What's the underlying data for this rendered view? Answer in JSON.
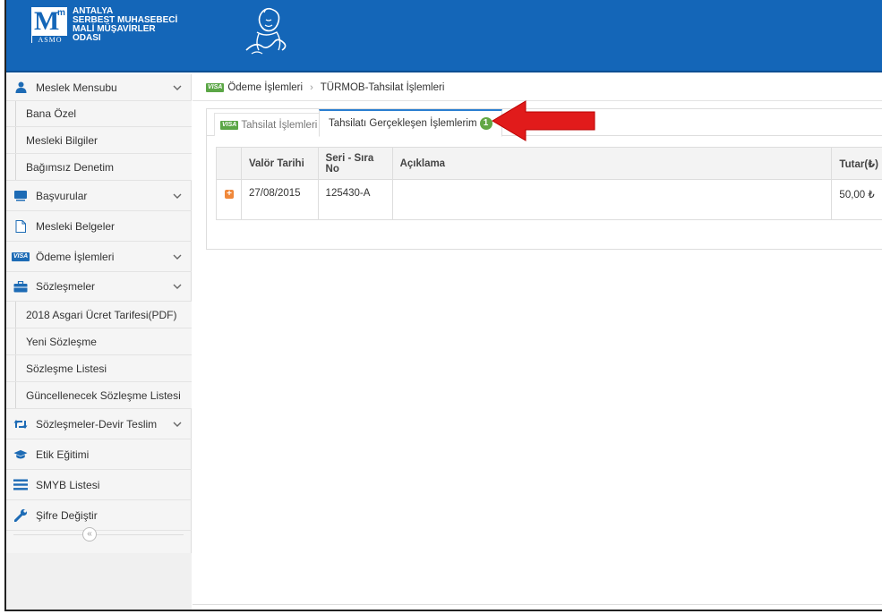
{
  "header": {
    "logo_letter": "M",
    "logo_sup": "m",
    "logo_badge": "ASMO",
    "org_lines": [
      "ANTALYA",
      "SERBEST MUHASEBECİ",
      "MALİ MÜŞAVİRLER",
      "ODASI"
    ]
  },
  "sidebar": {
    "items": [
      {
        "label": "Meslek Mensubu",
        "icon": "user-icon",
        "expandable": true
      },
      {
        "label": "Bana Özel",
        "sub": true
      },
      {
        "label": "Mesleki Bilgiler",
        "sub": true
      },
      {
        "label": "Bağımsız Denetim",
        "sub": true
      },
      {
        "label": "Başvurular",
        "icon": "monitor-icon",
        "expandable": true
      },
      {
        "label": "Mesleki Belgeler",
        "icon": "document-icon"
      },
      {
        "label": "Ödeme İşlemleri",
        "icon": "visa-icon",
        "expandable": true
      },
      {
        "label": "Sözleşmeler",
        "icon": "briefcase-icon",
        "expandable": true
      },
      {
        "label": "2018 Asgari Ücret Tarifesi(PDF)",
        "sub": true
      },
      {
        "label": "Yeni Sözleşme",
        "sub": true
      },
      {
        "label": "Sözleşme Listesi",
        "sub": true
      },
      {
        "label": "Güncellenecek Sözleşme Listesi",
        "sub": true
      },
      {
        "label": "Sözleşmeler-Devir Teslim",
        "icon": "retweet-icon",
        "expandable": true
      },
      {
        "label": "Etik Eğitimi",
        "icon": "graduation-cap-icon"
      },
      {
        "label": "SMYB Listesi",
        "icon": "list-icon"
      },
      {
        "label": "Şifre Değiştir",
        "icon": "wrench-icon"
      }
    ],
    "collapse_glyph": "«"
  },
  "breadcrumb": {
    "visa": "VISA",
    "items": [
      "Ödeme İşlemleri",
      "TÜRMOB-Tahsilat İşlemleri"
    ],
    "separator": "›"
  },
  "tabs": [
    {
      "label": "Tahsilat İşlemleri",
      "active": false,
      "visa": "VISA"
    },
    {
      "label": "Tahsilatı Gerçekleşen İşlemlerim",
      "active": true,
      "badge": "1"
    }
  ],
  "table": {
    "columns": [
      "Valör Tarihi",
      "Seri - Sıra No",
      "Açıklama",
      "Tutar(₺)"
    ],
    "rows": [
      {
        "expand": "+",
        "cells": [
          "27/08/2015",
          "125430-A",
          "",
          "50,00 ₺"
        ]
      }
    ]
  },
  "colors": {
    "header_bg": "#1466b8",
    "visa_green": "#5ba646",
    "badge_green": "#62a744",
    "expand_orange": "#f0883a",
    "arrow_red": "#e11b1b",
    "active_tab_border": "#2a7fd1"
  }
}
